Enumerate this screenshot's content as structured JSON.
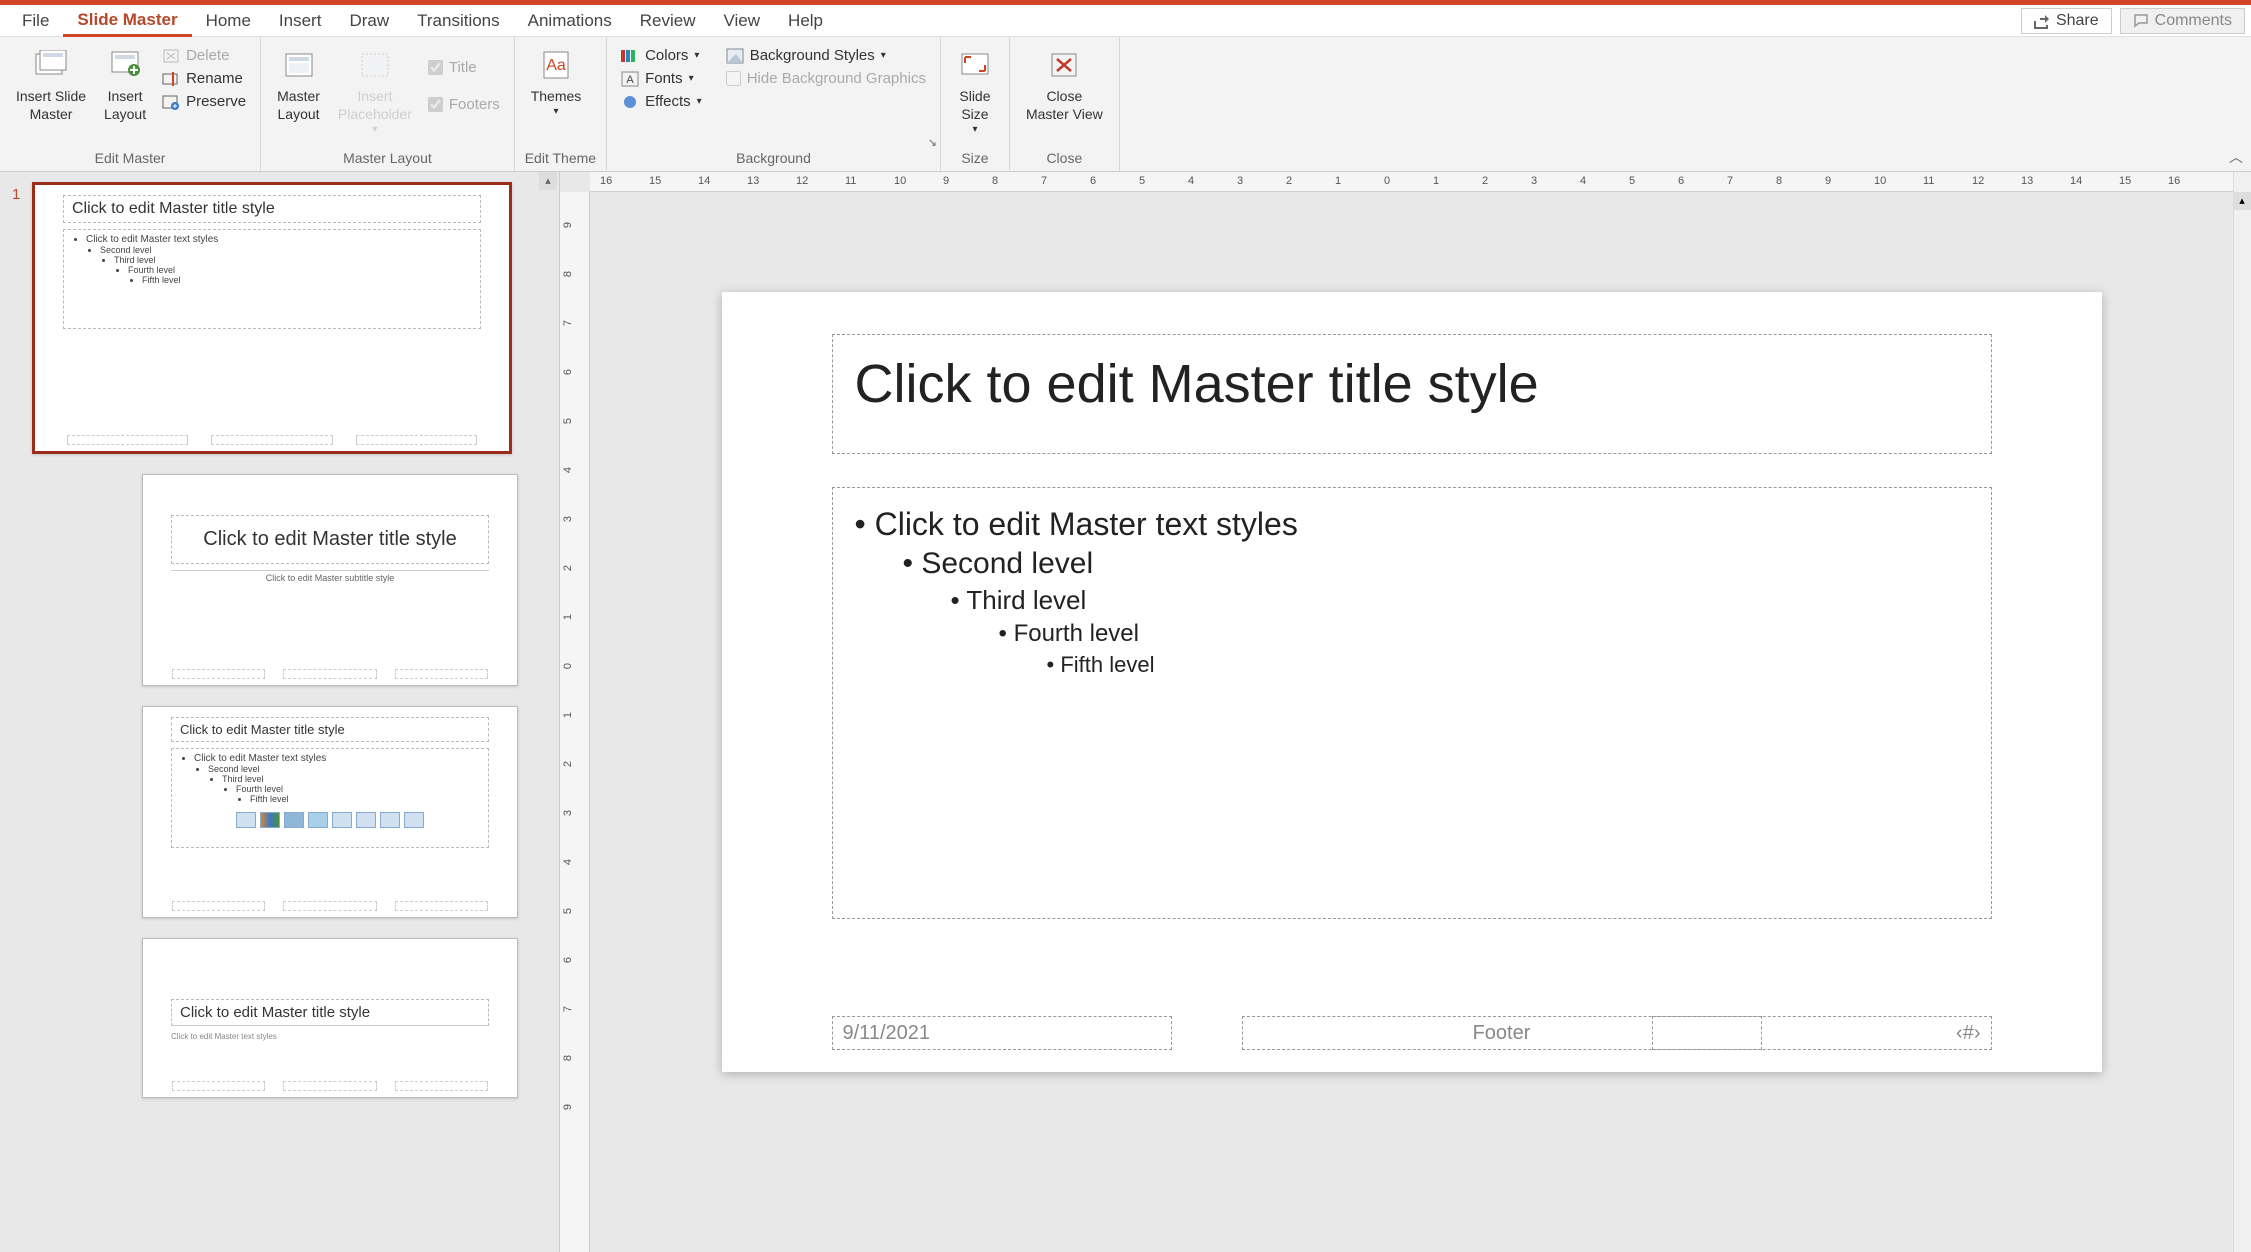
{
  "tabs": {
    "file": "File",
    "slide_master": "Slide Master",
    "home": "Home",
    "insert": "Insert",
    "draw": "Draw",
    "transitions": "Transitions",
    "animations": "Animations",
    "review": "Review",
    "view": "View",
    "help": "Help"
  },
  "top_right": {
    "share": "Share",
    "comments": "Comments"
  },
  "ribbon": {
    "edit_master": {
      "label": "Edit Master",
      "insert_slide_master": "Insert Slide\nMaster",
      "insert_layout": "Insert\nLayout",
      "delete": "Delete",
      "rename": "Rename",
      "preserve": "Preserve"
    },
    "master_layout": {
      "label": "Master Layout",
      "master_layout_btn": "Master\nLayout",
      "insert_placeholder": "Insert\nPlaceholder",
      "title_cb": "Title",
      "footers_cb": "Footers"
    },
    "edit_theme": {
      "label": "Edit Theme",
      "themes": "Themes"
    },
    "background": {
      "label": "Background",
      "colors": "Colors",
      "fonts": "Fonts",
      "effects": "Effects",
      "bg_styles": "Background Styles",
      "hide_bg": "Hide Background Graphics"
    },
    "size": {
      "label": "Size",
      "slide_size": "Slide\nSize"
    },
    "close": {
      "label": "Close",
      "close_master": "Close\nMaster View"
    }
  },
  "thumbnails": {
    "master_num": "1",
    "title_text": "Click to edit Master title style",
    "body_l1": "Click to edit Master text styles",
    "body_l2": "Second level",
    "body_l3": "Third level",
    "body_l4": "Fourth level",
    "body_l5": "Fifth level",
    "subtitle": "Click to edit Master subtitle style",
    "text_styles_small": "Click to edit Master text styles"
  },
  "slide": {
    "title": "Click to edit Master title style",
    "l1": "Click to edit Master text styles",
    "l2": "Second level",
    "l3": "Third level",
    "l4": "Fourth level",
    "l5": "Fifth level",
    "date": "9/11/2021",
    "footer": "Footer",
    "number": "‹#›"
  },
  "ruler_h": [
    "16",
    "15",
    "14",
    "13",
    "12",
    "11",
    "10",
    "9",
    "8",
    "7",
    "6",
    "5",
    "4",
    "3",
    "2",
    "1",
    "0",
    "1",
    "2",
    "3",
    "4",
    "5",
    "6",
    "7",
    "8",
    "9",
    "10",
    "11",
    "12",
    "13",
    "14",
    "15",
    "16"
  ],
  "ruler_v": [
    "9",
    "8",
    "7",
    "6",
    "5",
    "4",
    "3",
    "2",
    "1",
    "0",
    "1",
    "2",
    "3",
    "4",
    "5",
    "6",
    "7",
    "8",
    "9"
  ]
}
